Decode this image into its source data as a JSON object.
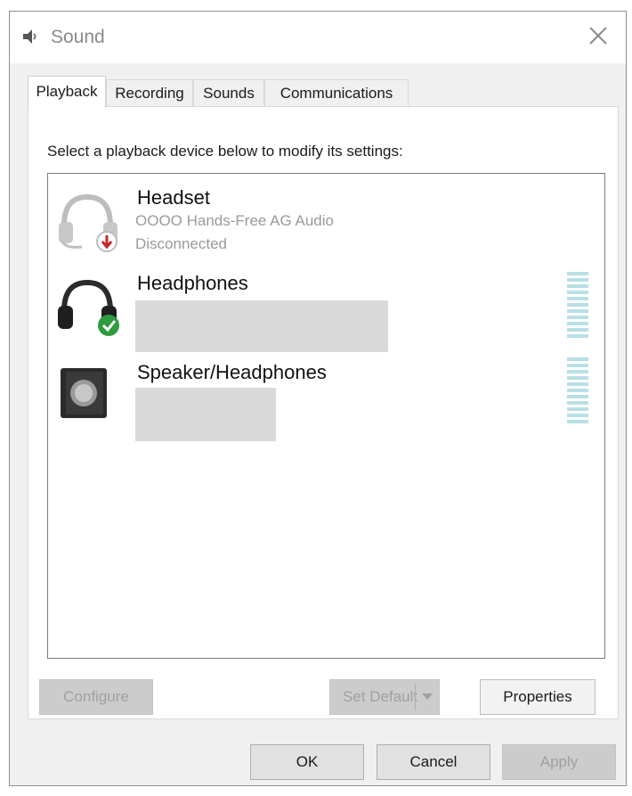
{
  "window": {
    "title": "Sound",
    "title_icon": "speaker-icon",
    "close_icon": "close-icon"
  },
  "tabs": [
    {
      "label": "Playback",
      "active": true
    },
    {
      "label": "Recording",
      "active": false
    },
    {
      "label": "Sounds",
      "active": false
    },
    {
      "label": "Communications",
      "active": false
    }
  ],
  "panel": {
    "instruction": "Select a playback device below to modify its settings:"
  },
  "devices": [
    {
      "name": "Headset",
      "description": "OOOO Hands-Free AG Audio",
      "status": "Disconnected",
      "icon": "headset-icon",
      "badge": "disconnected-badge"
    },
    {
      "name": "Headphones",
      "icon": "headphones-icon",
      "badge": "default-check-badge"
    },
    {
      "name": "Speaker/Headphones",
      "icon": "speaker-icon"
    }
  ],
  "buttons": {
    "configure": "Configure",
    "set_default": "Set Default",
    "properties": "Properties",
    "ok": "OK",
    "cancel": "Cancel",
    "apply": "Apply"
  },
  "colors": {
    "level_meter": "#b9dfe6",
    "check_badge": "#2e9b3e",
    "disconnect_badge": "#c62828"
  }
}
